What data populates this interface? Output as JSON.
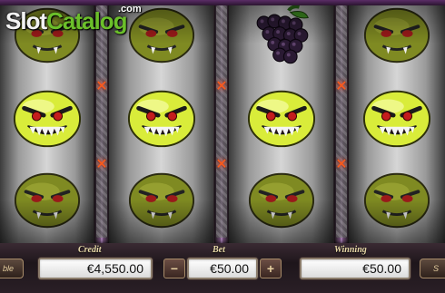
{
  "logo": {
    "slot": "Slot",
    "catalog": "Catalog",
    "com": ".com"
  },
  "reels": [
    {
      "name": "reel-1",
      "symbols": [
        "fanged-lime",
        "angry-lime",
        "fanged-lime"
      ]
    },
    {
      "name": "reel-2",
      "symbols": [
        "fanged-lime",
        "angry-lime",
        "fanged-lime"
      ]
    },
    {
      "name": "reel-3",
      "symbols": [
        "grapes",
        "angry-lime",
        "fanged-lime"
      ]
    },
    {
      "name": "reel-4",
      "symbols": [
        "fanged-lime",
        "angry-lime",
        "fanged-lime"
      ]
    }
  ],
  "bottom_bar": {
    "credit_label": "Credit",
    "credit_value": "€4,550.00",
    "bet_label": "Bet",
    "bet_value": "€50.00",
    "bet_minus": "−",
    "bet_plus": "+",
    "winning_label": "Winning",
    "winning_value": "€50.00",
    "left_button_text": "ble",
    "right_button_text": "S"
  },
  "colors": {
    "lime": "#d9ec3a",
    "lime_dark": "#7f8a22",
    "grape": "#2a1a33",
    "accent_purple": "#8a4f9a",
    "spark": "#ff5a1a"
  }
}
